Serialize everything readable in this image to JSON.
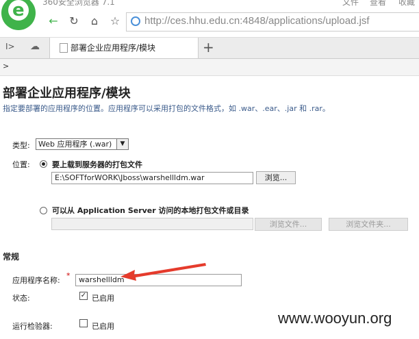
{
  "browser": {
    "title": "360安全浏览器 7.1",
    "menu": [
      "文件",
      "查看",
      "收藏"
    ],
    "url_domain": "http://ces.hhu.edu.cn",
    "url_rest": ":4848/applications/upload.jsf",
    "tab_label": "部署企业应用程序/模块",
    "logo_letter": "e",
    "accent": "#3fb34a"
  },
  "breadcrumb": ">",
  "page": {
    "title": "部署企业应用程序/模块",
    "description": "指定要部署的应用程序的位置。应用程序可以采用打包的文件格式，如 .war、.ear、.jar 和 .rar。"
  },
  "form": {
    "type_label": "类型:",
    "type_value": "Web 应用程序 (.war)",
    "location_label": "位置:",
    "option_upload": "要上载到服务器的打包文件",
    "upload_path": "E:\\SOFTforWORK\\Jboss\\warshellldm.war",
    "browse_label": "浏览...",
    "option_local": "可以从 Application Server 访问的本地打包文件或目录",
    "local_path": "",
    "browse_file_label": "浏览文件...",
    "browse_folder_label": "浏览文件夹...",
    "section_general": "常规",
    "app_name_label": "应用程序名称:",
    "required_mark": "*",
    "app_name_value": "warshellldm",
    "status_label": "状态:",
    "status_checked_label": "已启用",
    "validator_label": "运行检验器:",
    "validator_label2": "已启用"
  },
  "watermark": "www.wooyun.org"
}
